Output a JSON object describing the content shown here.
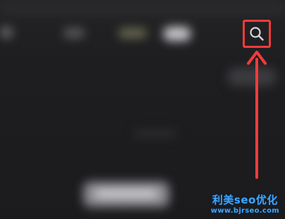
{
  "screen": {
    "background_color": "#1c1c1e"
  },
  "toolbar": {
    "search_icon": "search-icon",
    "highlight_color": "#f23b3b"
  },
  "annotation": {
    "arrow_color": "#f23b3b",
    "arrow_target": "search-icon"
  },
  "watermark": {
    "line1": "利美seo优化",
    "line2": "www.bjrseo.com",
    "color": "#3ea6ff"
  }
}
